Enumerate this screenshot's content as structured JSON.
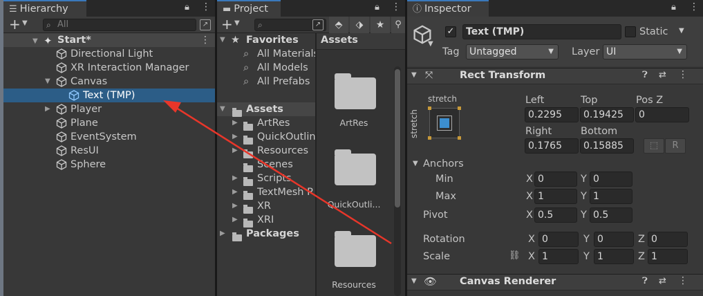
{
  "hierarchy": {
    "tab_label": "Hierarchy",
    "search_placeholder": "All",
    "scene": "Start*",
    "items": [
      {
        "label": "Directional Light"
      },
      {
        "label": "XR Interaction Manager"
      },
      {
        "label": "Canvas"
      },
      {
        "label": "Text (TMP)"
      },
      {
        "label": "Player"
      },
      {
        "label": "Plane"
      },
      {
        "label": "EventSystem"
      },
      {
        "label": "ResUI"
      },
      {
        "label": "Sphere"
      }
    ]
  },
  "project": {
    "tab_label": "Project",
    "favorites_label": "Favorites",
    "favorites": [
      "All Materials",
      "All Models",
      "All Prefabs"
    ],
    "assets_label": "Assets",
    "assets_folders": [
      "ArtRes",
      "QuickOutlin",
      "Resources",
      "Scenes",
      "Scripts",
      "TextMesh P",
      "XR",
      "XRI"
    ],
    "packages_label": "Packages",
    "grid_header": "Assets",
    "grid_items": [
      "ArtRes",
      "QuickOutli...",
      "Resources"
    ]
  },
  "inspector": {
    "tab_label": "Inspector",
    "object_name": "Text (TMP)",
    "static_label": "Static",
    "tag_label": "Tag",
    "tag_value": "Untagged",
    "layer_label": "Layer",
    "layer_value": "UI",
    "rect_transform": {
      "title": "Rect Transform",
      "anchor_preset_top": "stretch",
      "anchor_preset_side": "stretch",
      "left_label": "Left",
      "left": "0.2295",
      "top_label": "Top",
      "top": "0.19425",
      "posz_label": "Pos Z",
      "posz": "0",
      "right_label": "Right",
      "right": "0.1765",
      "bottom_label": "Bottom",
      "bottom": "0.15885",
      "r_button": "R",
      "anchors_label": "Anchors",
      "min_label": "Min",
      "min_x": "0",
      "min_y": "0",
      "max_label": "Max",
      "max_x": "1",
      "max_y": "1",
      "pivot_label": "Pivot",
      "pivot_x": "0.5",
      "pivot_y": "0.5",
      "rotation_label": "Rotation",
      "rot_x": "0",
      "rot_y": "0",
      "rot_z": "0",
      "scale_label": "Scale",
      "scale_x": "1",
      "scale_y": "1",
      "scale_z": "1",
      "x": "X",
      "y": "Y",
      "z": "Z"
    },
    "canvas_renderer": {
      "title": "Canvas Renderer"
    }
  },
  "colors": {
    "selection": "#2c5d87",
    "tab_accent": "#3a79bb",
    "arrow": "#e8362a"
  },
  "icons": [
    "hierarchy-icon",
    "project-folder-icon",
    "info-icon",
    "lock-icon",
    "menu-dots-icon",
    "gameobject-cube-icon",
    "unity-scene-icon",
    "star-icon",
    "folder-icon",
    "help-icon",
    "settings-sliders-icon",
    "eye-icon",
    "rect-tool-icon",
    "link-icon"
  ]
}
